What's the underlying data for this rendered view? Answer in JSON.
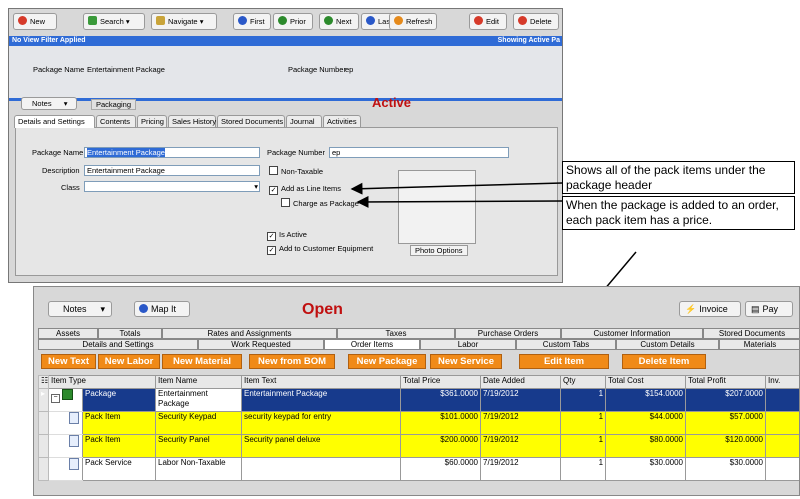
{
  "top_window": {
    "toolbar": {
      "new": "New",
      "search": "Search",
      "navigate": "Navigate",
      "first": "First",
      "prior": "Prior",
      "next": "Next",
      "last": "Last",
      "refresh": "Refresh",
      "edit": "Edit",
      "delete": "Delete"
    },
    "filter_bar": {
      "left": "No View Filter Applied",
      "right": "Showing Active Pa"
    },
    "header": {
      "package_name_label": "Package Name",
      "package_name_value": "Entertainment Package",
      "package_number_label": "Package Number",
      "package_number_value": "ep"
    },
    "notes_button": "Notes",
    "packaging_button": "Packaging",
    "status": "Active",
    "tabs": [
      "Details and Settings",
      "Contents",
      "Pricing",
      "Sales History",
      "Stored Documents",
      "Journal",
      "Activities"
    ],
    "form": {
      "package_name_label": "Package Name",
      "package_name_value": "Entertainment Package",
      "description_label": "Description",
      "description_value": "Entertainment Package",
      "class_label": "Class",
      "class_value": "",
      "package_number_label": "Package Number",
      "package_number_value": "ep",
      "non_taxable": "Non-Taxable",
      "add_as_line_items": "Add as Line Items",
      "charge_as_package": "Charge as Package",
      "is_active": "Is Active",
      "add_to_customer_equipment": "Add to Customer Equipment",
      "photo_options": "Photo Options"
    }
  },
  "callouts": {
    "first": "Shows all of the pack items under the package header",
    "second": "When the package is added to an order, each pack item has a price."
  },
  "bottom_window": {
    "notes_button": "Notes",
    "map_it_button": "Map It",
    "status": "Open",
    "invoice_button": "Invoice",
    "pay_button": "Pay",
    "tab_rows": {
      "row1": [
        "Assets",
        "Totals",
        "Rates and Assignments",
        "Taxes",
        "Purchase Orders",
        "Customer Information",
        "Stored Documents"
      ],
      "row2": [
        "Details and Settings",
        "Work Requested",
        "Order Items",
        "Labor",
        "Custom Tabs",
        "Custom Details",
        "Materials"
      ]
    },
    "action_buttons": [
      "New Text",
      "New Labor",
      "New Material",
      "New from BOM",
      "New Package",
      "New Service",
      "Edit Item",
      "Delete Item"
    ],
    "grid": {
      "columns": [
        "Item Type",
        "Item Name",
        "Item Text",
        "Total Price",
        "Date Added",
        "Qty",
        "Total Cost",
        "Total Profit",
        "Inv."
      ],
      "rows": [
        {
          "type": "Package",
          "name": "Entertainment Package",
          "text": "Entertainment Package",
          "price": "$361.0000",
          "date": "7/19/2012",
          "qty": "1",
          "cost": "$154.0000",
          "profit": "$207.0000"
        },
        {
          "type": "Pack Item",
          "name": "Security Keypad",
          "text": "security keypad for entry",
          "price": "$101.0000",
          "date": "7/19/2012",
          "qty": "1",
          "cost": "$44.0000",
          "profit": "$57.0000"
        },
        {
          "type": "Pack Item",
          "name": "Security Panel",
          "text": "Security panel deluxe",
          "price": "$200.0000",
          "date": "7/19/2012",
          "qty": "1",
          "cost": "$80.0000",
          "profit": "$120.0000"
        },
        {
          "type": "Pack Service",
          "name": "Labor Non-Taxable",
          "text": "",
          "price": "$60.0000",
          "date": "7/19/2012",
          "qty": "1",
          "cost": "$30.0000",
          "profit": "$30.0000"
        }
      ]
    }
  }
}
